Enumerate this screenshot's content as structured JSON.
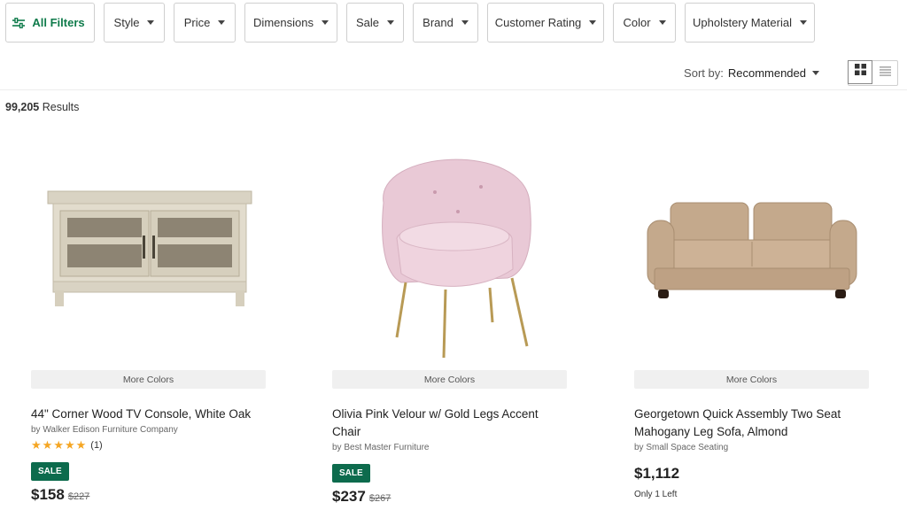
{
  "filters": {
    "all_filters": "All Filters",
    "items": [
      "Style",
      "Price",
      "Dimensions",
      "Sale",
      "Brand",
      "Customer Rating",
      "Color",
      "Upholstery Material"
    ]
  },
  "sort": {
    "label": "Sort by:",
    "value": "Recommended"
  },
  "view": {
    "active": "grid"
  },
  "results": {
    "count": "99,205",
    "label": "Results"
  },
  "products": [
    {
      "more_colors": "More Colors",
      "title": "44\" Corner Wood TV Console, White Oak",
      "brand": "by Walker Edison Furniture Company",
      "rating": 5,
      "rating_count": "(1)",
      "badge": "SALE",
      "price": "$158",
      "was_price": "$227"
    },
    {
      "more_colors": "More Colors",
      "title": "Olivia Pink Velour w/ Gold Legs Accent Chair",
      "brand": "by Best Master Furniture",
      "badge": "SALE",
      "price": "$237",
      "was_price": "$267"
    },
    {
      "more_colors": "More Colors",
      "title": "Georgetown Quick Assembly Two Seat Mahogany Leg Sofa, Almond",
      "brand": "by Small Space Seating",
      "price": "$1,112",
      "stock": "Only 1 Left"
    }
  ],
  "colors": {
    "accent": "#0f7b4b",
    "sale_badge": "#0d6b4d",
    "star": "#f5a623"
  }
}
